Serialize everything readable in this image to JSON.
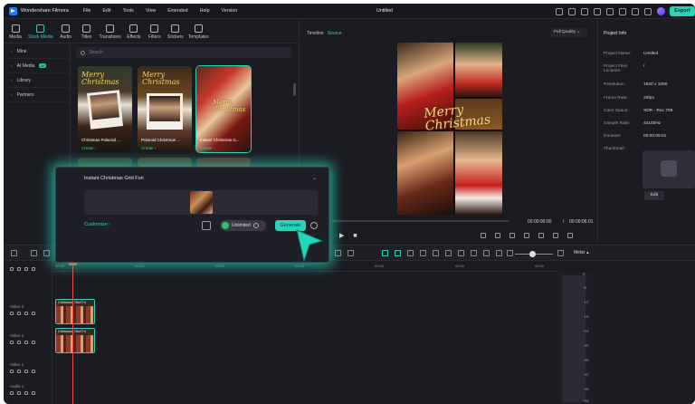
{
  "app": {
    "name": "Wondershare Filmora",
    "doc_title": "Untitled",
    "export_label": "Export"
  },
  "menu": [
    "File",
    "Edit",
    "Tools",
    "View",
    "Extended",
    "Help",
    "Version"
  ],
  "tabs": [
    "Media",
    "Stock Media",
    "Audio",
    "Titles",
    "Transitions",
    "Effects",
    "Filters",
    "Stickers",
    "Templates"
  ],
  "active_tab": "Stock Media",
  "sidenav": [
    {
      "label": "Mine"
    },
    {
      "label": "AI Media",
      "badge": "AI"
    },
    {
      "label": "Library"
    },
    {
      "label": "Partners"
    }
  ],
  "search": {
    "placeholder": "Search"
  },
  "cards": [
    {
      "caption": "Christmas Polaroid ...",
      "action": "Create",
      "title": "Merry Christmas"
    },
    {
      "caption": "Polaroid Christmas ...",
      "action": "Create",
      "title": "Merry Christmas"
    },
    {
      "caption": "Instant Christmas G...",
      "action": "Create",
      "title": "Merry Christmas"
    }
  ],
  "popup": {
    "title": "Instant Christmas Grid Fun",
    "customize": "Customize",
    "unlimited": "Unlimited",
    "generate": "Generate"
  },
  "preview": {
    "tab_timeline": "Timeline",
    "tab_source": "Source",
    "quality": "Full Quality",
    "current_time": "00:00:00:00",
    "separator": "/",
    "total_time": "00:00:05:01",
    "poster_title_1": "Merry",
    "poster_title_2": "Christmas"
  },
  "project_info": {
    "heading": "Project Info",
    "rows": [
      {
        "k": "Project Name:",
        "v": "Untitled"
      },
      {
        "k": "Project Files Location:",
        "v": "/"
      },
      {
        "k": "Resolution:",
        "v": "1920 x 1080"
      },
      {
        "k": "Frame Rate:",
        "v": "25fps"
      },
      {
        "k": "Color Space:",
        "v": "SDR - Rec.709"
      },
      {
        "k": "Sample Rate:",
        "v": "44100Hz"
      },
      {
        "k": "Duration:",
        "v": "00:00:05:01"
      },
      {
        "k": "Thumbnail:",
        "v": ""
      }
    ],
    "edit_label": "Edit"
  },
  "toolbar": {
    "meter_label": "Meter"
  },
  "ruler": [
    "00:00",
    "00:10",
    "00:20",
    "00:30",
    "00:40",
    "00:50",
    "01:00"
  ],
  "tracks": [
    {
      "label": "Video 3"
    },
    {
      "label": "Video 2"
    },
    {
      "label": "Video 1"
    },
    {
      "label": "Audio 1"
    }
  ],
  "clips": [
    {
      "label": "Christmas Grid Fu"
    },
    {
      "label": "Christmas Grid Fu"
    }
  ],
  "meter_scale": [
    "0",
    "-6",
    "-12",
    "-18",
    "-24",
    "-30",
    "-36",
    "-42",
    "-48",
    "-54"
  ],
  "colors": {
    "accent": "#28d4b8",
    "playhead": "#e84a4a",
    "background": "#1b1b22"
  }
}
